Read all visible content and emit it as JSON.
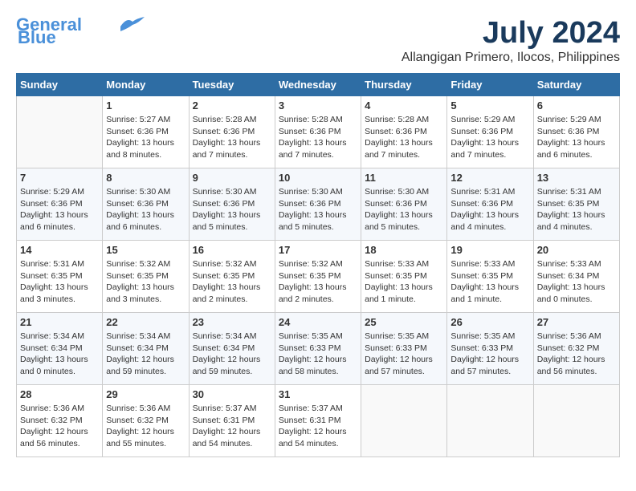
{
  "header": {
    "logo_general": "General",
    "logo_blue": "Blue",
    "month_year": "July 2024",
    "location": "Allangigan Primero, Ilocos, Philippines"
  },
  "weekdays": [
    "Sunday",
    "Monday",
    "Tuesday",
    "Wednesday",
    "Thursday",
    "Friday",
    "Saturday"
  ],
  "weeks": [
    [
      {
        "day": "",
        "info": ""
      },
      {
        "day": "1",
        "info": "Sunrise: 5:27 AM\nSunset: 6:36 PM\nDaylight: 13 hours\nand 8 minutes."
      },
      {
        "day": "2",
        "info": "Sunrise: 5:28 AM\nSunset: 6:36 PM\nDaylight: 13 hours\nand 7 minutes."
      },
      {
        "day": "3",
        "info": "Sunrise: 5:28 AM\nSunset: 6:36 PM\nDaylight: 13 hours\nand 7 minutes."
      },
      {
        "day": "4",
        "info": "Sunrise: 5:28 AM\nSunset: 6:36 PM\nDaylight: 13 hours\nand 7 minutes."
      },
      {
        "day": "5",
        "info": "Sunrise: 5:29 AM\nSunset: 6:36 PM\nDaylight: 13 hours\nand 7 minutes."
      },
      {
        "day": "6",
        "info": "Sunrise: 5:29 AM\nSunset: 6:36 PM\nDaylight: 13 hours\nand 6 minutes."
      }
    ],
    [
      {
        "day": "7",
        "info": "Sunrise: 5:29 AM\nSunset: 6:36 PM\nDaylight: 13 hours\nand 6 minutes."
      },
      {
        "day": "8",
        "info": "Sunrise: 5:30 AM\nSunset: 6:36 PM\nDaylight: 13 hours\nand 6 minutes."
      },
      {
        "day": "9",
        "info": "Sunrise: 5:30 AM\nSunset: 6:36 PM\nDaylight: 13 hours\nand 5 minutes."
      },
      {
        "day": "10",
        "info": "Sunrise: 5:30 AM\nSunset: 6:36 PM\nDaylight: 13 hours\nand 5 minutes."
      },
      {
        "day": "11",
        "info": "Sunrise: 5:30 AM\nSunset: 6:36 PM\nDaylight: 13 hours\nand 5 minutes."
      },
      {
        "day": "12",
        "info": "Sunrise: 5:31 AM\nSunset: 6:36 PM\nDaylight: 13 hours\nand 4 minutes."
      },
      {
        "day": "13",
        "info": "Sunrise: 5:31 AM\nSunset: 6:35 PM\nDaylight: 13 hours\nand 4 minutes."
      }
    ],
    [
      {
        "day": "14",
        "info": "Sunrise: 5:31 AM\nSunset: 6:35 PM\nDaylight: 13 hours\nand 3 minutes."
      },
      {
        "day": "15",
        "info": "Sunrise: 5:32 AM\nSunset: 6:35 PM\nDaylight: 13 hours\nand 3 minutes."
      },
      {
        "day": "16",
        "info": "Sunrise: 5:32 AM\nSunset: 6:35 PM\nDaylight: 13 hours\nand 2 minutes."
      },
      {
        "day": "17",
        "info": "Sunrise: 5:32 AM\nSunset: 6:35 PM\nDaylight: 13 hours\nand 2 minutes."
      },
      {
        "day": "18",
        "info": "Sunrise: 5:33 AM\nSunset: 6:35 PM\nDaylight: 13 hours\nand 1 minute."
      },
      {
        "day": "19",
        "info": "Sunrise: 5:33 AM\nSunset: 6:35 PM\nDaylight: 13 hours\nand 1 minute."
      },
      {
        "day": "20",
        "info": "Sunrise: 5:33 AM\nSunset: 6:34 PM\nDaylight: 13 hours\nand 0 minutes."
      }
    ],
    [
      {
        "day": "21",
        "info": "Sunrise: 5:34 AM\nSunset: 6:34 PM\nDaylight: 13 hours\nand 0 minutes."
      },
      {
        "day": "22",
        "info": "Sunrise: 5:34 AM\nSunset: 6:34 PM\nDaylight: 12 hours\nand 59 minutes."
      },
      {
        "day": "23",
        "info": "Sunrise: 5:34 AM\nSunset: 6:34 PM\nDaylight: 12 hours\nand 59 minutes."
      },
      {
        "day": "24",
        "info": "Sunrise: 5:35 AM\nSunset: 6:33 PM\nDaylight: 12 hours\nand 58 minutes."
      },
      {
        "day": "25",
        "info": "Sunrise: 5:35 AM\nSunset: 6:33 PM\nDaylight: 12 hours\nand 57 minutes."
      },
      {
        "day": "26",
        "info": "Sunrise: 5:35 AM\nSunset: 6:33 PM\nDaylight: 12 hours\nand 57 minutes."
      },
      {
        "day": "27",
        "info": "Sunrise: 5:36 AM\nSunset: 6:32 PM\nDaylight: 12 hours\nand 56 minutes."
      }
    ],
    [
      {
        "day": "28",
        "info": "Sunrise: 5:36 AM\nSunset: 6:32 PM\nDaylight: 12 hours\nand 56 minutes."
      },
      {
        "day": "29",
        "info": "Sunrise: 5:36 AM\nSunset: 6:32 PM\nDaylight: 12 hours\nand 55 minutes."
      },
      {
        "day": "30",
        "info": "Sunrise: 5:37 AM\nSunset: 6:31 PM\nDaylight: 12 hours\nand 54 minutes."
      },
      {
        "day": "31",
        "info": "Sunrise: 5:37 AM\nSunset: 6:31 PM\nDaylight: 12 hours\nand 54 minutes."
      },
      {
        "day": "",
        "info": ""
      },
      {
        "day": "",
        "info": ""
      },
      {
        "day": "",
        "info": ""
      }
    ]
  ]
}
